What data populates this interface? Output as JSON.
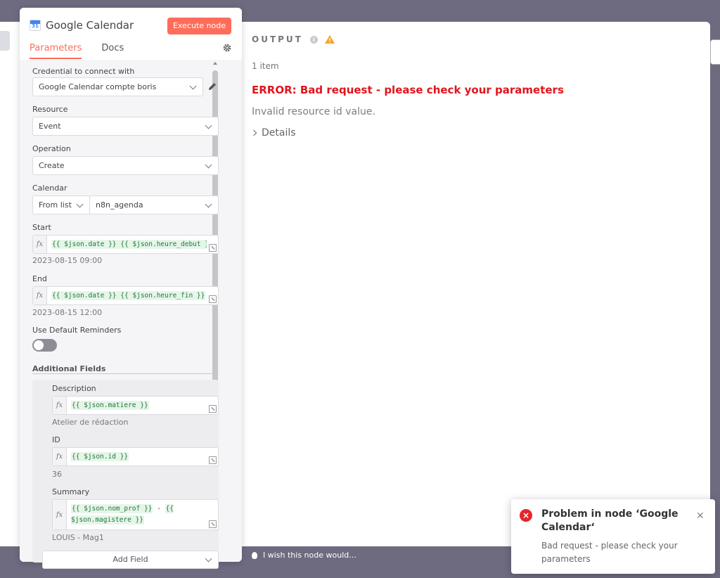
{
  "node": {
    "title": "Google Calendar",
    "icon": "google-calendar-icon",
    "icon_number": "31",
    "execute_label": "Execute node",
    "tabs": [
      {
        "label": "Parameters",
        "active": true
      },
      {
        "label": "Docs",
        "active": false
      }
    ]
  },
  "params": {
    "credential": {
      "label": "Credential to connect with",
      "value": "Google Calendar compte boris"
    },
    "resource": {
      "label": "Resource",
      "value": "Event"
    },
    "operation": {
      "label": "Operation",
      "value": "Create"
    },
    "calendar": {
      "label": "Calendar",
      "mode": "From list",
      "value": "n8n_agenda"
    },
    "start": {
      "label": "Start",
      "expression": "{{ $json.date }} {{ $json.heure_debut }}",
      "hint": "2023-08-15 09:00"
    },
    "end": {
      "label": "End",
      "expression": "{{ $json.date }} {{ $json.heure_fin }}",
      "hint": "2023-08-15 12:00"
    },
    "reminders": {
      "label": "Use Default Reminders",
      "enabled": false
    },
    "additional": {
      "title": "Additional Fields",
      "description": {
        "label": "Description",
        "expression": "{{ $json.matiere }}",
        "hint": "Atelier de rédaction"
      },
      "id": {
        "label": "ID",
        "expression": "{{ $json.id }}",
        "hint": "36"
      },
      "summary": {
        "label": "Summary",
        "expr1": "{{ $json.nom_prof }}",
        "sep": " - ",
        "expr2": "{{ $json.magistere }}",
        "hint": "LOUIS - Mag1"
      },
      "add_field_label": "Add Field"
    }
  },
  "output": {
    "title": "OUTPUT",
    "count": "1 item",
    "error_title": "ERROR: Bad request - please check your parameters",
    "error_message": "Invalid resource id value.",
    "details_label": "Details"
  },
  "feedback": {
    "label": "I wish this node would..."
  },
  "toast": {
    "title": "Problem in node ‘Google Calendar‘",
    "message": "Bad request - please check your parameters"
  },
  "colors": {
    "accent": "#ff6d5a",
    "error": "#e0151c",
    "code": "#1e7a38",
    "backdrop": "#6e6b80"
  }
}
